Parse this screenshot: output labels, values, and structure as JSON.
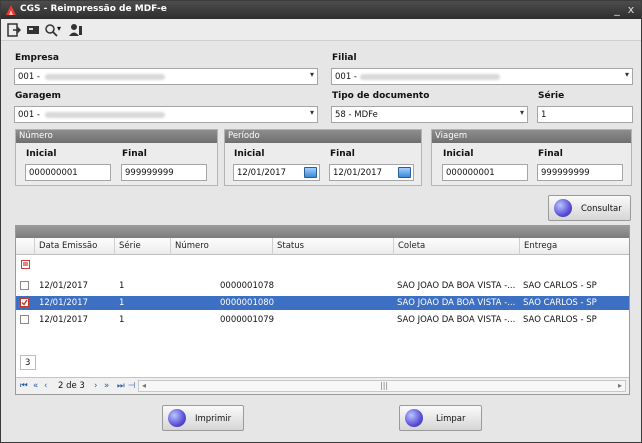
{
  "window": {
    "title": "CGS - Reimpressão de MDF-e",
    "minimize": "_",
    "close": "x"
  },
  "toolbar": {
    "icons": [
      "exit-icon",
      "card-icon",
      "search-icon",
      "user-icon"
    ]
  },
  "form": {
    "empresa_label": "Empresa",
    "empresa_value": "001 -",
    "filial_label": "Filial",
    "filial_value": "001 -",
    "garagem_label": "Garagem",
    "garagem_value": "001 -",
    "tipo_label": "Tipo de documento",
    "tipo_value": "58 - MDFe",
    "serie_label": "Série",
    "serie_value": "1"
  },
  "groups": {
    "numero": {
      "title": "Número",
      "inicial_label": "Inicial",
      "inicial": "000000001",
      "final_label": "Final",
      "final": "999999999"
    },
    "periodo": {
      "title": "Período",
      "inicial_label": "Inicial",
      "inicial": "12/01/2017",
      "final_label": "Final",
      "final": "12/01/2017"
    },
    "viagem": {
      "title": "Viagem",
      "inicial_label": "Inicial",
      "inicial": "000000001",
      "final_label": "Final",
      "final": "999999999"
    }
  },
  "consultar_label": "Consultar",
  "grid": {
    "columns": [
      "Data Emissão",
      "Série",
      "Número",
      "Status",
      "Coleta",
      "Entrega"
    ],
    "rows": [
      {
        "data": "12/01/2017",
        "serie": "1",
        "numero": "0000001078",
        "status": "",
        "coleta": "SAO JOAO DA BOA VISTA -...",
        "entrega": "SAO CARLOS - SP",
        "checked": false,
        "selected": false
      },
      {
        "data": "12/01/2017",
        "serie": "1",
        "numero": "0000001080",
        "status": "",
        "coleta": "SAO JOAO DA BOA VISTA -...",
        "entrega": "SAO CARLOS - SP",
        "checked": true,
        "selected": true
      },
      {
        "data": "12/01/2017",
        "serie": "1",
        "numero": "0000001079",
        "status": "",
        "coleta": "SAO JOAO DA BOA VISTA -...",
        "entrega": "SAO CARLOS - SP",
        "checked": false,
        "selected": false
      }
    ],
    "footer_count": "3",
    "pager_text": "2 de 3"
  },
  "buttons": {
    "imprimir": "Imprimir",
    "limpar": "Limpar"
  }
}
